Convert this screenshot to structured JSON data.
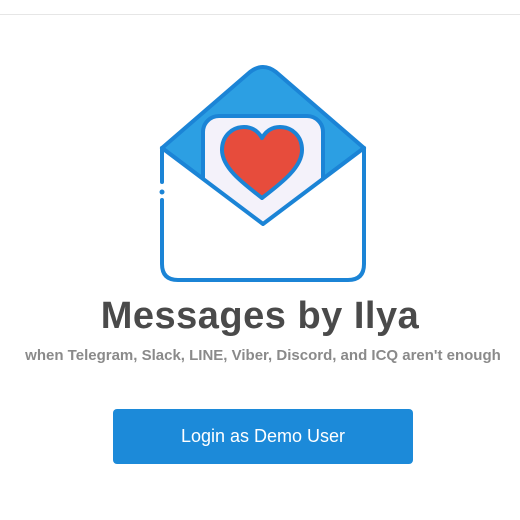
{
  "app": {
    "title": "Messages by Ilya",
    "tagline": "when Telegram, Slack, LINE, Viber, Discord, and ICQ aren't enough",
    "logo_icon": "open-envelope-heart-icon"
  },
  "actions": {
    "login_label": "Login as Demo User"
  },
  "colors": {
    "primary": "#1c8ad9",
    "envelope_stroke": "#1b84d6",
    "envelope_flap": "#2c9fe3",
    "heart": "#e74c3c",
    "title": "#4a4a4a",
    "tagline": "#8a8a8a"
  }
}
